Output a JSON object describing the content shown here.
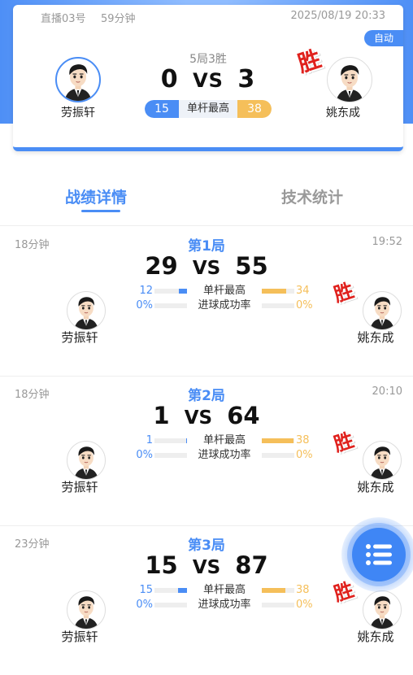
{
  "header": {
    "room": "直播03号",
    "duration": "59分钟",
    "datetime": "2025/08/19 20:33",
    "auto_badge": "自动",
    "format": "5局3胜",
    "score_left": "0",
    "vs": "VS",
    "score_right": "3",
    "high_break_label": "单杆最高",
    "high_break_left": "15",
    "high_break_right": "38",
    "player_left": "劳振轩",
    "player_right": "姚东成",
    "win_mark": "胜"
  },
  "tabs": {
    "active": "战绩详情",
    "inactive": "技术统计"
  },
  "games": [
    {
      "title": "第1局",
      "duration": "18分钟",
      "time": "19:52",
      "score_left": "29",
      "vs": "VS",
      "score_right": "55",
      "player_left": "劳振轩",
      "player_right": "姚东成",
      "win_mark": "胜",
      "stat1_label": "单杆最高",
      "stat1_left": "12",
      "stat1_right": "34",
      "stat1_left_ratio": 0.26,
      "stat1_right_ratio": 0.74,
      "stat2_label": "进球成功率",
      "stat2_left": "0%",
      "stat2_right": "0%",
      "stat2_left_ratio": 0,
      "stat2_right_ratio": 0
    },
    {
      "title": "第2局",
      "duration": "18分钟",
      "time": "20:10",
      "score_left": "1",
      "vs": "VS",
      "score_right": "64",
      "player_left": "劳振轩",
      "player_right": "姚东成",
      "win_mark": "胜",
      "stat1_label": "单杆最高",
      "stat1_left": "1",
      "stat1_right": "38",
      "stat1_left_ratio": 0.03,
      "stat1_right_ratio": 0.97,
      "stat2_label": "进球成功率",
      "stat2_left": "0%",
      "stat2_right": "0%",
      "stat2_left_ratio": 0,
      "stat2_right_ratio": 0
    },
    {
      "title": "第3局",
      "duration": "23分钟",
      "time": "",
      "score_left": "15",
      "vs": "VS",
      "score_right": "87",
      "player_left": "劳振轩",
      "player_right": "姚东成",
      "win_mark": "胜",
      "stat1_label": "单杆最高",
      "stat1_left": "15",
      "stat1_right": "38",
      "stat1_left_ratio": 0.28,
      "stat1_right_ratio": 0.72,
      "stat2_label": "进球成功率",
      "stat2_left": "0%",
      "stat2_right": "0%",
      "stat2_left_ratio": 0,
      "stat2_right_ratio": 0
    }
  ],
  "colors": {
    "accent": "#4a8df5",
    "gold": "#f5bf5a",
    "win_red": "#e0211d"
  },
  "icons": {
    "avatar": "player-avatar-icon",
    "fab": "list-menu-icon"
  }
}
